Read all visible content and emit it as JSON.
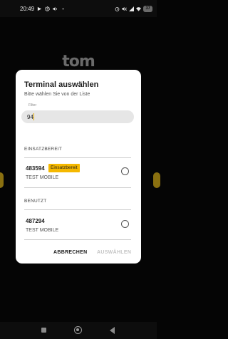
{
  "status_bar": {
    "time": "20:49",
    "battery": "37",
    "icons": [
      "play-icon",
      "gear-icon",
      "volume-icon",
      "dot-icon",
      "alarm-icon",
      "mute-icon",
      "signal-icon",
      "wifi-icon",
      "battery-icon"
    ]
  },
  "background": {
    "logo_text": "tom",
    "accent_color": "#f5b800"
  },
  "dialog": {
    "title": "Terminal auswählen",
    "subtitle": "Bitte wählen Sie von der Liste",
    "filter": {
      "label": "Filter",
      "value": "94"
    },
    "sections": [
      {
        "header": "EINSATZBEREIT",
        "items": [
          {
            "id": "483594",
            "badge": "Einsatzbereit",
            "name": "TEST MOBILE",
            "selected": false
          }
        ]
      },
      {
        "header": "BENUTZT",
        "items": [
          {
            "id": "487294",
            "badge": "",
            "name": "TEST MOBILE",
            "selected": false
          }
        ]
      }
    ],
    "buttons": {
      "cancel": "ABBRECHEN",
      "select": "AUSWÄHLEN"
    }
  },
  "nav_bar": {
    "icons": [
      "recents-icon",
      "home-icon",
      "back-icon"
    ]
  }
}
